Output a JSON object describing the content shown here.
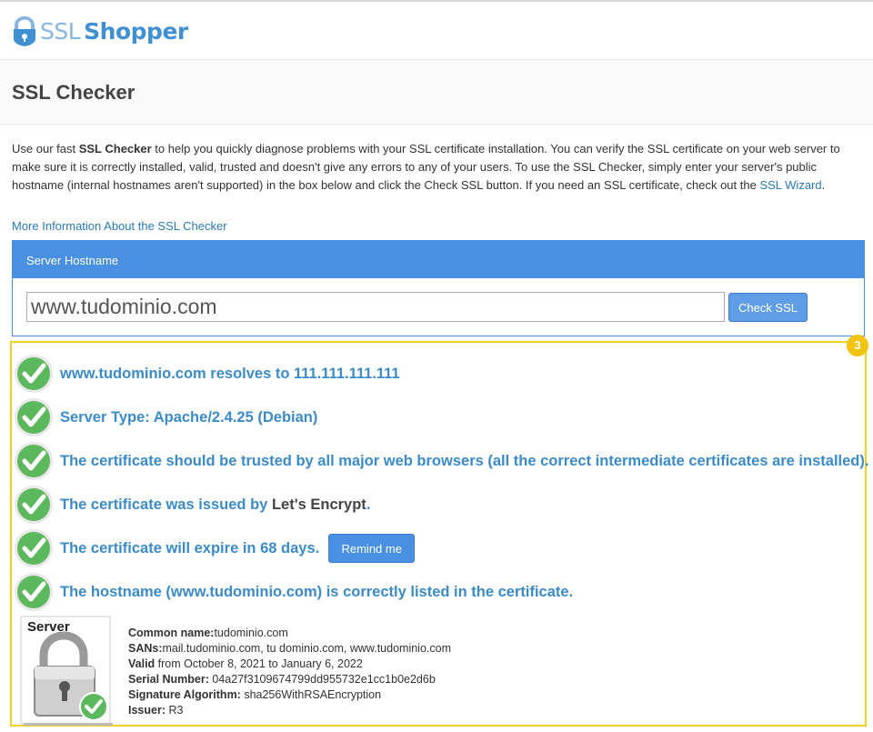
{
  "brand": {
    "ssl": "SSL",
    "shopper": "Shopper"
  },
  "page_title": "SSL Checker",
  "intro": {
    "p1": "Use our fast ",
    "b1": "SSL Checker",
    "p2": " to help you quickly diagnose problems with your SSL certificate installation. You can verify the SSL certificate on your web server to make sure it is correctly installed, valid, trusted and doesn't give any errors to any of your users. To use the SSL Checker, simply enter your server's public hostname (internal hostnames aren't supported) in the box below and click the Check SSL button. If you need an SSL certificate, check out the ",
    "link": "SSL Wizard",
    "p3": "."
  },
  "more_info_link": "More Information About the SSL Checker",
  "form": {
    "panel_title": "Server Hostname",
    "hostname_value": "www.tudominio.com",
    "check_button": "Check SSL"
  },
  "annotation_badge": "3",
  "results": [
    {
      "text": "www.tudominio.com resolves to 111.111.111.111"
    },
    {
      "text": "Server Type: Apache/2.4.25 (Debian)"
    },
    {
      "text": "The certificate should be trusted by all major web browsers (all the correct intermediate certificates are installed)."
    },
    {
      "text": "The certificate was issued by ",
      "issuer": "Let's Encrypt",
      "suffix": "."
    },
    {
      "text": "The certificate will expire in 68 days.",
      "button": "Remind me"
    },
    {
      "text": "The hostname (www.tudominio.com) is correctly listed in the certificate."
    }
  ],
  "cert": {
    "image_label": "Server",
    "common_name_label": "Common name:",
    "common_name": "tudominio.com",
    "sans_label": "SANs:",
    "sans": "mail.tudominio.com, tu dominio.com, www.tudominio.com",
    "valid_label": "Valid",
    "valid": " from October 8, 2021 to January 6, 2022",
    "serial_label": "Serial Number:",
    "serial": " 04a27f3109674799dd955732e1cc1b0e2d6b",
    "sig_label": "Signature Algorithm:",
    "sig": " sha256WithRSAEncryption",
    "issuer_label": "Issuer:",
    "issuer": " R3"
  },
  "colors": {
    "accent": "#4a90e2",
    "link": "#2a7ab8",
    "result_text": "#3b8bc8",
    "highlight_border": "#f2d024",
    "check_green": "#5cb85c"
  },
  "icons": [
    "shield-lock-logo-icon",
    "check-mark-icon",
    "server-padlock-icon"
  ]
}
